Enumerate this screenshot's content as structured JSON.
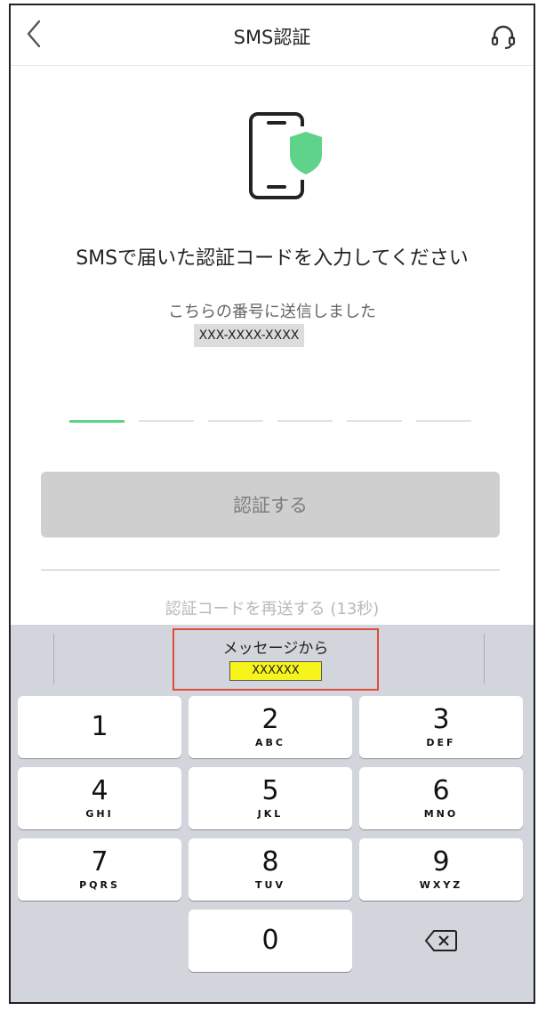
{
  "header": {
    "title": "SMS認証",
    "back_icon": "chevron-left-icon",
    "support_icon": "headset-icon"
  },
  "main": {
    "illustration_icon": "phone-shield-icon",
    "heading": "SMSで届いた認証コードを入力してください",
    "sent_note": "こちらの番号に送信しました",
    "phone_number": "XXX-XXXX-XXXX",
    "code_length": 6,
    "verify_label": "認証する",
    "resend_label": "認証コードを再送する (13秒)"
  },
  "keyboard": {
    "suggestion_label": "メッセージから",
    "suggestion_code": "XXXXXX",
    "keys": [
      {
        "num": "1",
        "letters": ""
      },
      {
        "num": "2",
        "letters": "ABC"
      },
      {
        "num": "3",
        "letters": "DEF"
      },
      {
        "num": "4",
        "letters": "GHI"
      },
      {
        "num": "5",
        "letters": "JKL"
      },
      {
        "num": "6",
        "letters": "MNO"
      },
      {
        "num": "7",
        "letters": "PQRS"
      },
      {
        "num": "8",
        "letters": "TUV"
      },
      {
        "num": "9",
        "letters": "WXYZ"
      },
      {
        "num": "0",
        "letters": ""
      }
    ],
    "delete_icon": "backspace-icon"
  },
  "colors": {
    "accent": "#5fd38a",
    "highlight_border": "#e24b3b",
    "highlight_fill": "#f7f41c"
  }
}
